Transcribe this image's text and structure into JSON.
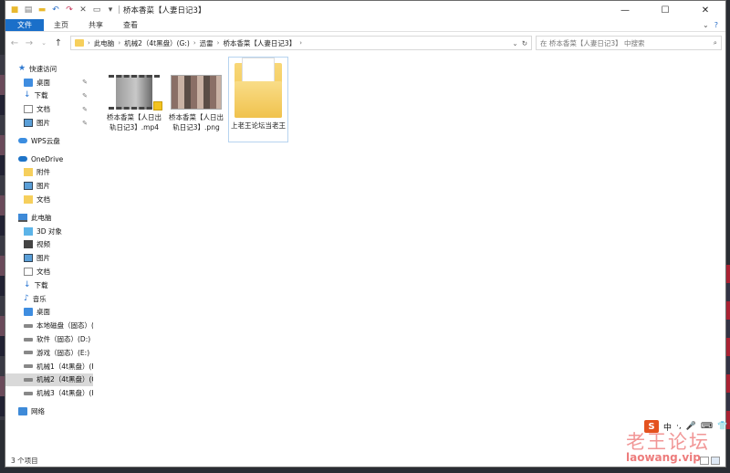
{
  "window": {
    "title": "桥本香菜【人妻日记3】",
    "controls": [
      "—",
      "☐",
      "✕"
    ]
  },
  "ribbon": {
    "tabs": [
      "文件",
      "主页",
      "共享",
      "查看"
    ],
    "expand": "⌄",
    "help": "?"
  },
  "address": {
    "crumbs": [
      "此电脑",
      "机械2（4t黑盘）(G:)",
      "迅雷",
      "桥本香菜【人妻日记3】"
    ],
    "dropdown": "⌄",
    "refresh": "↻"
  },
  "search": {
    "placeholder": "在 桥本香菜【人妻日记3】 中搜索"
  },
  "nav": {
    "quick_access": "快速访问",
    "quick_items": [
      "桌面",
      "下载",
      "文档",
      "图片"
    ],
    "wps": "WPS云盘",
    "onedrive": "OneDrive",
    "onedrive_items": [
      "附件",
      "图片",
      "文档"
    ],
    "this_pc": "此电脑",
    "pc_items": [
      "3D 对象",
      "视频",
      "图片",
      "文档",
      "下载",
      "音乐",
      "桌面"
    ],
    "drives": [
      "本地磁盘（固态）(",
      "软件（固态）(D:)",
      "游戏（固态）(E:)",
      "机械1（4t黑盘）(F",
      "机械2（4t黑盘）(G",
      "机械3（4t黑盘）(H"
    ],
    "network": "网络"
  },
  "files": [
    {
      "name": "桥本香菜【人日出轨日记3】.mp4",
      "type": "video"
    },
    {
      "name": "桥本香菜【人日出轨日记3】.png",
      "type": "image"
    },
    {
      "name": "上老王论坛当老王",
      "type": "folder"
    }
  ],
  "status": {
    "count": "3 个项目"
  },
  "ime": {
    "logo": "S",
    "items": [
      "中",
      "·,",
      "🎤",
      "⌨",
      "👕"
    ]
  },
  "watermark": {
    "text": "老王论坛",
    "url": "laowang.vip"
  }
}
